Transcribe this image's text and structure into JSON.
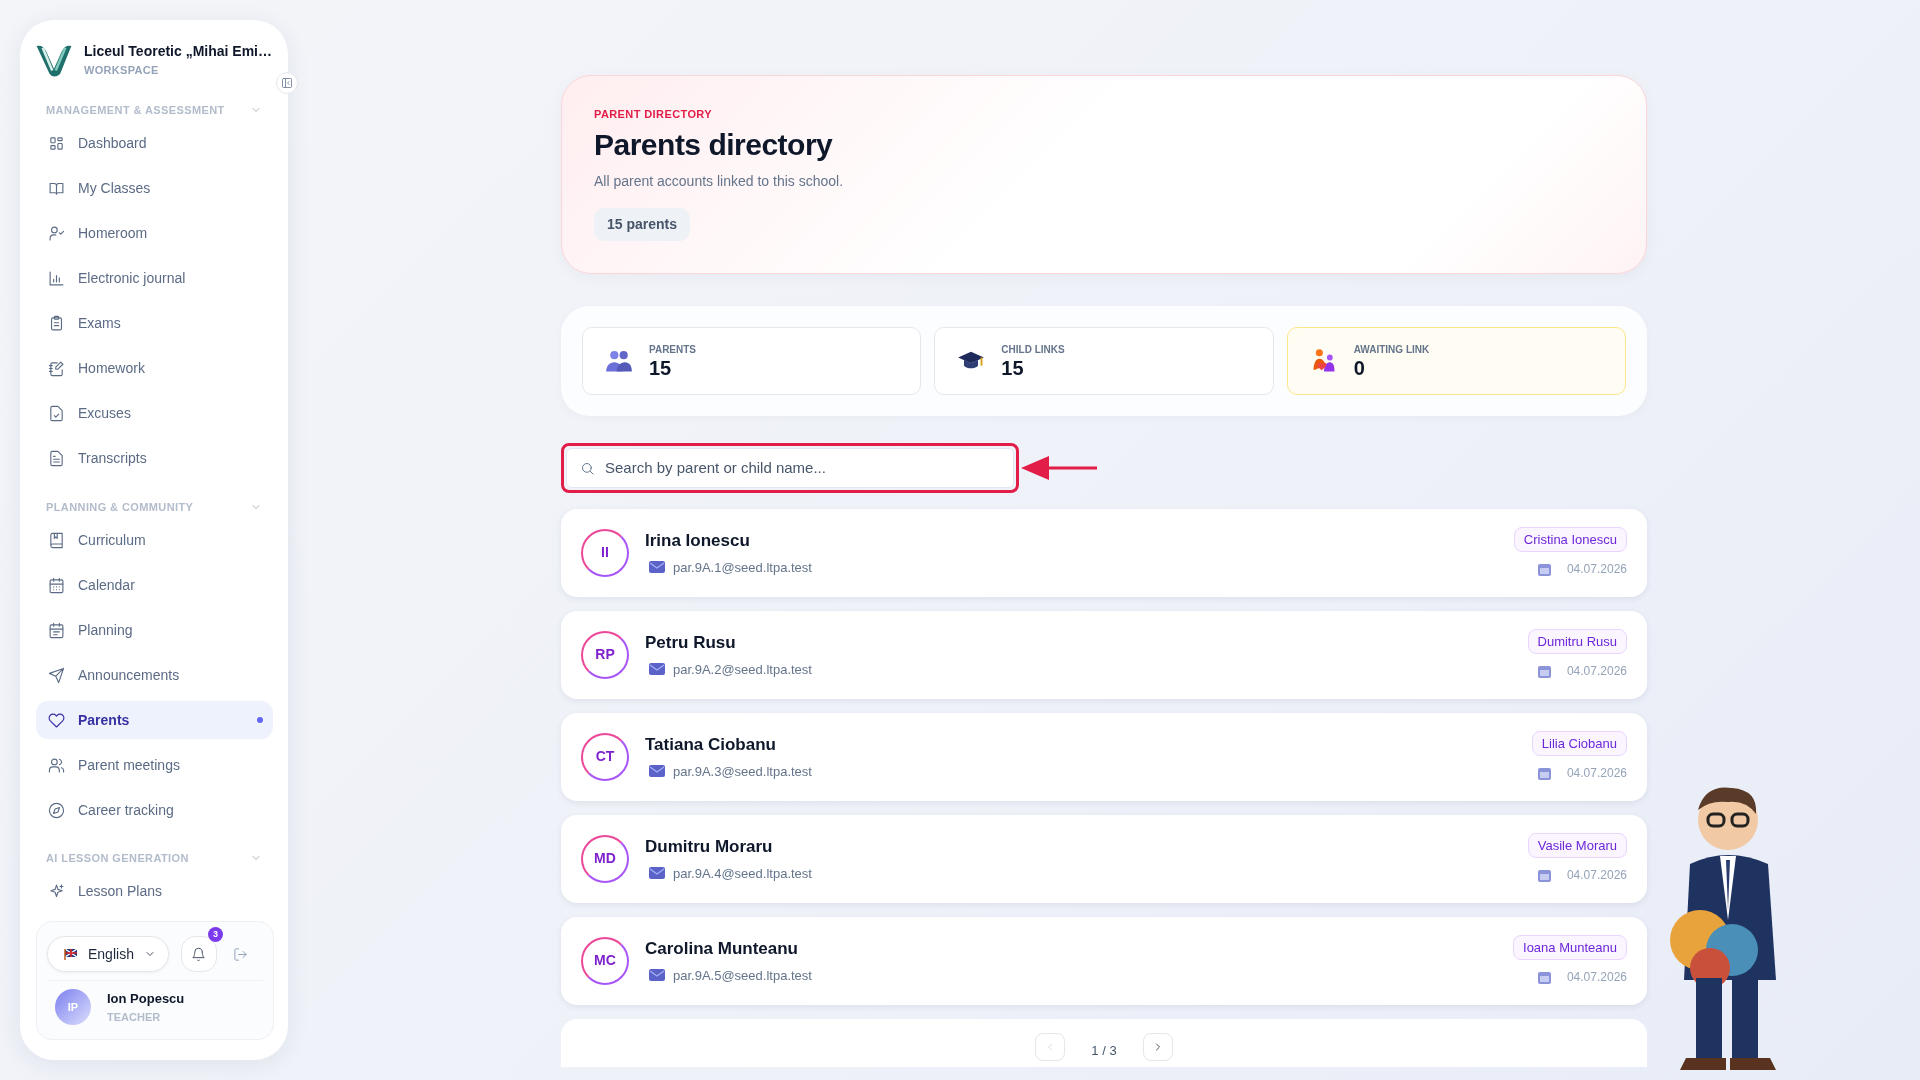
{
  "sidebar": {
    "school": "Liceul Teoretic „Mihai Emi…",
    "workspace": "WORKSPACE",
    "sections": [
      {
        "title": "MANAGEMENT & ASSESSMENT",
        "expanded": true,
        "items": [
          {
            "label": "Dashboard",
            "selected": false
          },
          {
            "label": "My Classes",
            "selected": false
          },
          {
            "label": "Homeroom",
            "selected": false
          },
          {
            "label": "Electronic journal",
            "selected": false
          },
          {
            "label": "Exams",
            "selected": false
          },
          {
            "label": "Homework",
            "selected": false
          },
          {
            "label": "Excuses",
            "selected": false
          },
          {
            "label": "Transcripts",
            "selected": false
          }
        ]
      },
      {
        "title": "PLANNING & COMMUNITY",
        "expanded": true,
        "items": [
          {
            "label": "Curriculum",
            "selected": false
          },
          {
            "label": "Calendar",
            "selected": false
          },
          {
            "label": "Planning",
            "selected": false
          },
          {
            "label": "Announcements",
            "selected": false
          },
          {
            "label": "Parents",
            "selected": true
          },
          {
            "label": "Parent meetings",
            "selected": false
          },
          {
            "label": "Career tracking",
            "selected": false
          }
        ]
      },
      {
        "title": "AI LESSON GENERATION",
        "expanded": true,
        "items": [
          {
            "label": "Lesson Plans",
            "selected": false
          }
        ]
      }
    ],
    "language": "English",
    "notifications": "3",
    "user": {
      "initials": "IP",
      "name": "Ion Popescu",
      "role": "TEACHER"
    }
  },
  "header": {
    "eyebrow": "PARENT DIRECTORY",
    "title": "Parents directory",
    "subtitle": "All parent accounts linked to this school.",
    "count": "15 parents"
  },
  "stats": [
    {
      "label": "PARENTS",
      "value": "15",
      "highlighted": false
    },
    {
      "label": "CHILD LINKS",
      "value": "15",
      "highlighted": false
    },
    {
      "label": "AWAITING LINK",
      "value": "0",
      "highlighted": true
    }
  ],
  "search": {
    "placeholder": "Search by parent or child name..."
  },
  "parents": [
    {
      "initials": "II",
      "name": "Irina Ionescu",
      "email": "par.9A.1@seed.ltpa.test",
      "child": "Cristina Ionescu",
      "date": "04.07.2026"
    },
    {
      "initials": "RP",
      "name": "Petru Rusu",
      "email": "par.9A.2@seed.ltpa.test",
      "child": "Dumitru Rusu",
      "date": "04.07.2026"
    },
    {
      "initials": "CT",
      "name": "Tatiana Ciobanu",
      "email": "par.9A.3@seed.ltpa.test",
      "child": "Lilia Ciobanu",
      "date": "04.07.2026"
    },
    {
      "initials": "MD",
      "name": "Dumitru Moraru",
      "email": "par.9A.4@seed.ltpa.test",
      "child": "Vasile Moraru",
      "date": "04.07.2026"
    },
    {
      "initials": "MC",
      "name": "Carolina Munteanu",
      "email": "par.9A.5@seed.ltpa.test",
      "child": "Ioana Munteanu",
      "date": "04.07.2026"
    }
  ],
  "pagination": {
    "page": "1 / 3"
  }
}
